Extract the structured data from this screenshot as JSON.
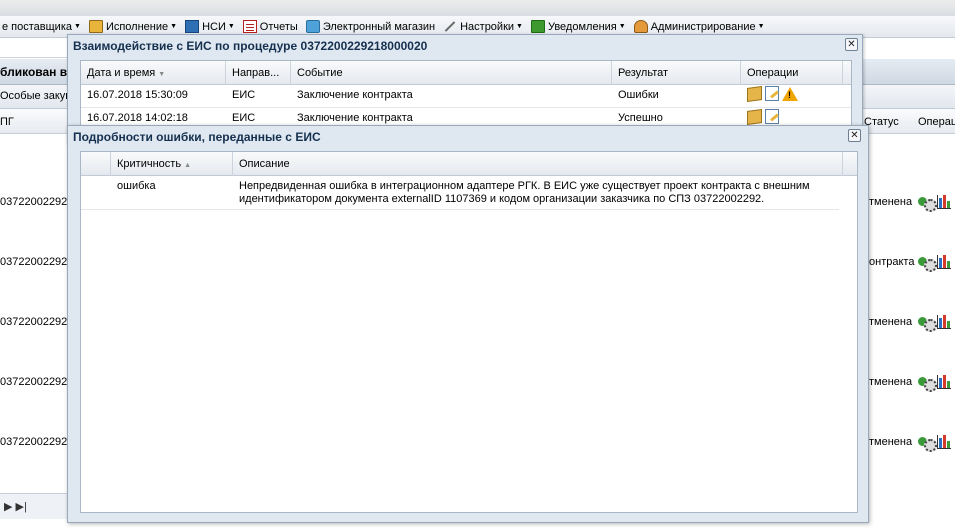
{
  "menu": {
    "items": [
      {
        "label": "е поставщика",
        "icon": ""
      },
      {
        "label": "Исполнение",
        "icon": "folder-icon"
      },
      {
        "label": "НСИ",
        "icon": "book-icon"
      },
      {
        "label": "Отчеты",
        "icon": "report-icon"
      },
      {
        "label": "Электронный магазин",
        "icon": "cart-icon"
      },
      {
        "label": "Настройки",
        "icon": "wrench-icon"
      },
      {
        "label": "Уведомления",
        "icon": "notification-icon"
      },
      {
        "label": "Администрирование",
        "icon": "admin-icon"
      }
    ]
  },
  "background": {
    "title_fragment": "бликован в",
    "tab_fragment": "Особые закуп",
    "col_left": "ПГ",
    "col_status": "Статус",
    "col_ops": "Операц",
    "rows": [
      {
        "id": "03722002292.",
        "status": "тменена"
      },
      {
        "id": "03722002292.",
        "status": "онтракта"
      },
      {
        "id": "03722002292.",
        "status": "тменена"
      },
      {
        "id": "03722002292.",
        "status": "тменена"
      },
      {
        "id": "03722002292.",
        "status": "тменена"
      }
    ],
    "pager": "▶ ▶|"
  },
  "window1": {
    "title": "Взаимодействие с ЕИС по процедуре 0372200229218000020",
    "columns": [
      "Дата и время",
      "Направ...",
      "Событие",
      "Результат",
      "Операции"
    ],
    "rows": [
      {
        "datetime": "16.07.2018 15:30:09",
        "direction": "ЕИС",
        "event": "Заключение контракта",
        "result": "Ошибки"
      },
      {
        "datetime": "16.07.2018 14:02:18",
        "direction": "ЕИС",
        "event": "Заключение контракта",
        "result": "Успешно"
      }
    ]
  },
  "window2": {
    "title": "Подробности ошибки, переданные с ЕИС",
    "columns": [
      "Критичность",
      "Описание"
    ],
    "rows": [
      {
        "severity": "ошибка",
        "description": "Непредвиденная ошибка в интеграционном адаптере РГК. В ЕИС уже существует проект контракта с внешним идентификатором документа externalID 1107369 и кодом организации заказчика по СПЗ 03722002292."
      }
    ]
  },
  "close_symbol": "✕"
}
